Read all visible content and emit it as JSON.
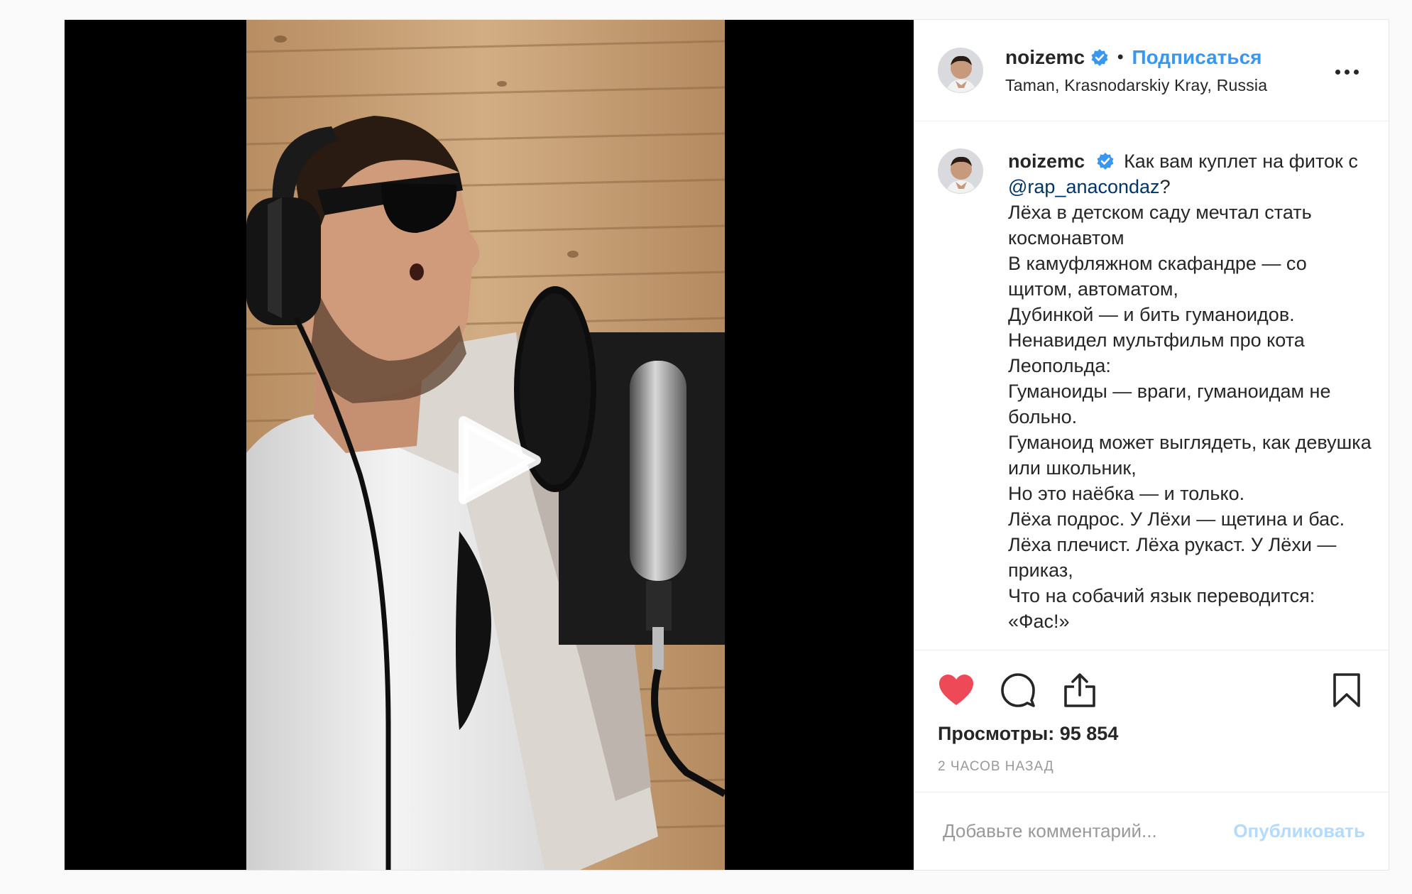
{
  "header": {
    "username": "noizemc",
    "separator": "•",
    "follow_label": "Подписаться",
    "location": "Taman, Krasnodarskiy Kray, Russia"
  },
  "caption": {
    "username": "noizemc",
    "first_text": "Как вам куплет на фиток с",
    "mention": "@rap_anacondaz",
    "mention_suffix": "?",
    "lines": [
      "Лёха в детском саду мечтал стать космонавтом",
      "В камуфляжном скафандре — со щитом, автоматом,",
      "Дубинкой — и бить гуманоидов.",
      "Ненавидел мультфильм про кота Леопольда:",
      "Гуманоиды — враги, гуманоидам не больно.",
      "Гуманоид может выглядеть, как девушка или школьник,",
      "Но это наёбка — и только.",
      "Лёха подрос. У Лёхи — щетина и бас.",
      "Лёха плечист. Лёха рукаст. У Лёхи — приказ,",
      "Что на собачий язык переводится: «Фас!»"
    ]
  },
  "stats": {
    "views": "Просмотры: 95 854",
    "timestamp": "2 часов назад"
  },
  "comment": {
    "placeholder": "Добавьте комментарий...",
    "publish_label": "Опубликовать"
  },
  "icons": {
    "verified": "verified-badge-icon",
    "like": "heart-icon",
    "comment": "comment-icon",
    "share": "share-icon",
    "save": "bookmark-icon",
    "more": "more-options-icon",
    "play": "play-icon"
  },
  "colors": {
    "like_active": "#ed4956",
    "link": "#3897f0",
    "mention": "#003569",
    "publish_disabled": "#b3dbff",
    "muted": "#999999"
  }
}
